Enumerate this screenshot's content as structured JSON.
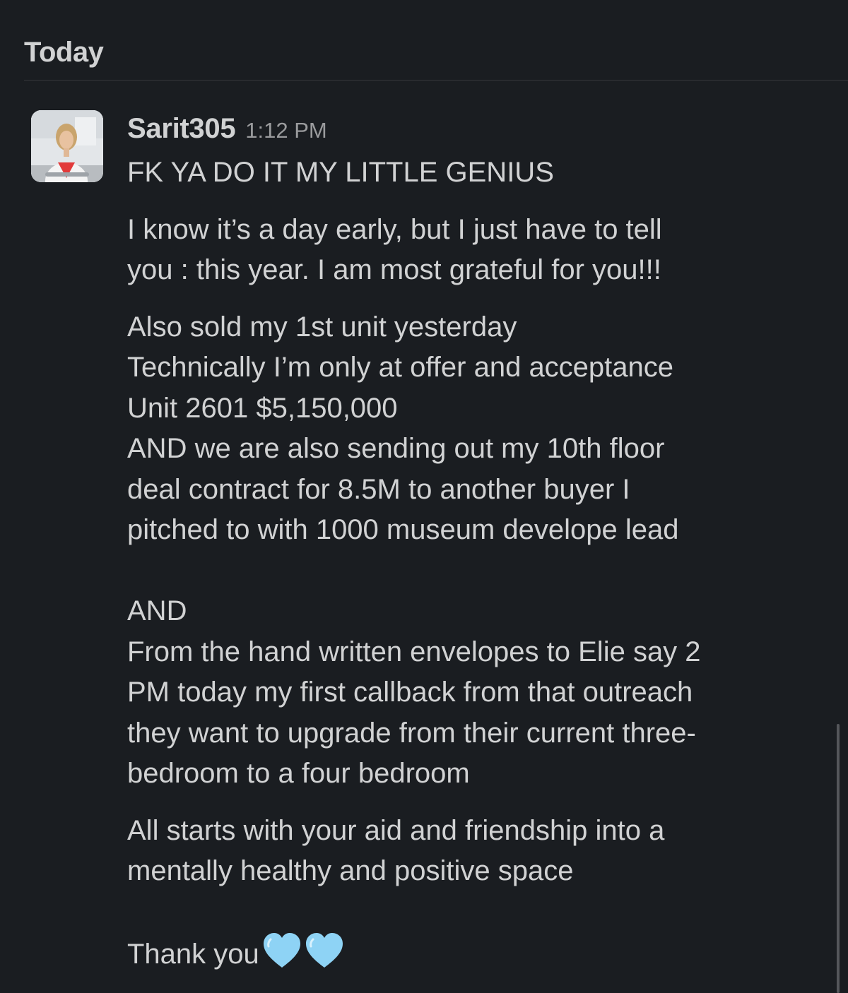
{
  "day_divider": {
    "label": "Today"
  },
  "message": {
    "sender": "Sarit305",
    "timestamp": "1:12 PM",
    "avatar_icon": "profile-photo",
    "paragraphs": [
      [
        "FK YA DO IT MY LITTLE GENIUS"
      ],
      [
        "I know it’s a day early, but I just have to tell",
        "you : this year. I am most grateful for you!!!"
      ],
      [
        "Also sold my 1st unit yesterday",
        "Technically I’m only at offer and acceptance",
        "Unit 2601 $5,150,000",
        "AND we are also sending out my 10th floor",
        "deal contract for 8.5M to another buyer I",
        "pitched to with 1000 museum develope lead",
        "",
        "AND",
        "From the hand written envelopes to Elie say 2",
        "PM today my first callback from that outreach",
        "they want to upgrade from their current three-",
        "bedroom to a four bedroom"
      ],
      [
        "All starts with your aid and friendship into a",
        "mentally healthy and positive space",
        "",
        "Thank you"
      ]
    ],
    "reaction_icons": [
      "light-blue-heart-icon",
      "light-blue-heart-icon"
    ],
    "heart_color": "#8ed3f5"
  },
  "colors": {
    "background": "#1a1d21",
    "text": "#d1d2d3",
    "muted": "#9a9b9d"
  }
}
